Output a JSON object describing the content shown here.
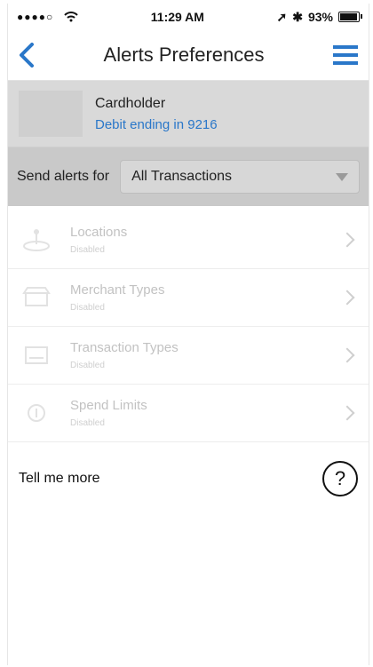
{
  "status": {
    "time": "11:29 AM",
    "battery": "93%"
  },
  "nav": {
    "title": "Alerts Preferences"
  },
  "card": {
    "name": "Cardholder",
    "sub": "Debit ending in 9216"
  },
  "send": {
    "label": "Send alerts for",
    "selected": "All Transactions"
  },
  "rows": [
    {
      "label": "Locations",
      "state": "Disabled",
      "icon": "location-icon"
    },
    {
      "label": "Merchant Types",
      "state": "Disabled",
      "icon": "merchant-icon"
    },
    {
      "label": "Transaction Types",
      "state": "Disabled",
      "icon": "transaction-icon"
    },
    {
      "label": "Spend Limits",
      "state": "Disabled",
      "icon": "spend-icon"
    }
  ],
  "more": {
    "label": "Tell me more",
    "help_symbol": "?"
  },
  "colors": {
    "accent": "#2a77c9",
    "card_bg": "#d9d9d9",
    "send_bg": "#c9c9c9"
  }
}
